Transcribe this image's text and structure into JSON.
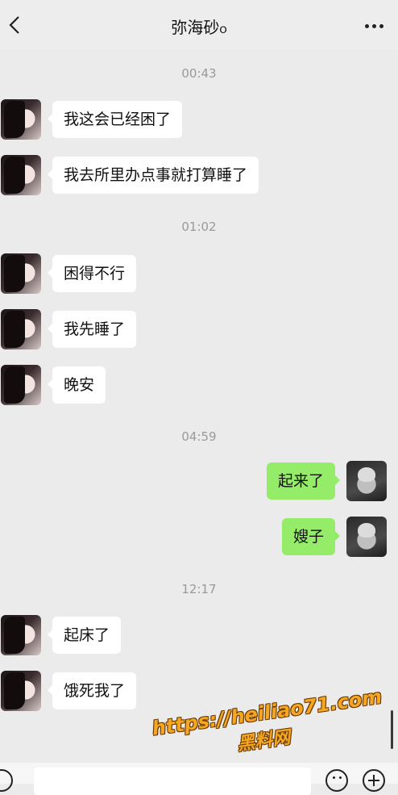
{
  "header": {
    "title": "弥海砂ჿ"
  },
  "messages": [
    {
      "type": "time",
      "text": "00:43"
    },
    {
      "type": "in",
      "text": "我这会已经困了"
    },
    {
      "type": "in",
      "text": "我去所里办点事就打算睡了"
    },
    {
      "type": "time",
      "text": "01:02"
    },
    {
      "type": "in",
      "text": "困得不行"
    },
    {
      "type": "in",
      "text": "我先睡了"
    },
    {
      "type": "in",
      "text": "晚安"
    },
    {
      "type": "time",
      "text": "04:59"
    },
    {
      "type": "out",
      "text": "起来了"
    },
    {
      "type": "out",
      "text": "嫂子"
    },
    {
      "type": "time",
      "text": "12:17"
    },
    {
      "type": "in",
      "text": "起床了"
    },
    {
      "type": "in",
      "text": "饿死我了"
    }
  ],
  "watermark": {
    "url": "https://heiliao71.com",
    "name": "黑料网"
  },
  "icons": {
    "back": "chevron-left-icon",
    "more": "more-dots-icon",
    "voice": "voice-icon",
    "emoji": "emoji-icon",
    "plus": "plus-icon"
  },
  "colors": {
    "background": "#ebebeb",
    "bubble_in": "#ffffff",
    "bubble_out": "#95ec69"
  }
}
